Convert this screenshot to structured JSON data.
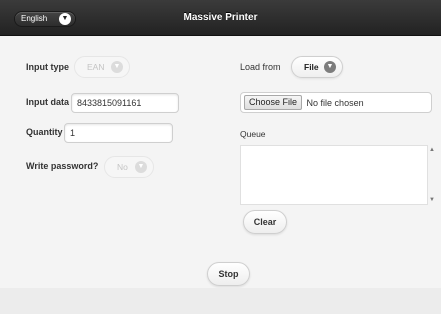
{
  "header": {
    "title": "Massive Printer",
    "language": "English"
  },
  "form": {
    "input_type": {
      "label": "Input type",
      "value": "EAN"
    },
    "input_data": {
      "label": "Input data",
      "value": "8433815091161"
    },
    "quantity": {
      "label": "Quantity",
      "value": "1"
    },
    "write_password": {
      "label": "Write password?",
      "value": "No"
    }
  },
  "right": {
    "load_from": {
      "label": "Load from",
      "value": "File"
    },
    "file": {
      "button": "Choose File",
      "status": "No file chosen"
    },
    "queue": {
      "label": "Queue"
    },
    "clear_label": "Clear"
  },
  "actions": {
    "stop_label": "Stop"
  },
  "icons": {
    "chevron": "chevron-down-icon",
    "scroll_up": "scroll-up-icon",
    "scroll_down": "scroll-down-icon"
  }
}
